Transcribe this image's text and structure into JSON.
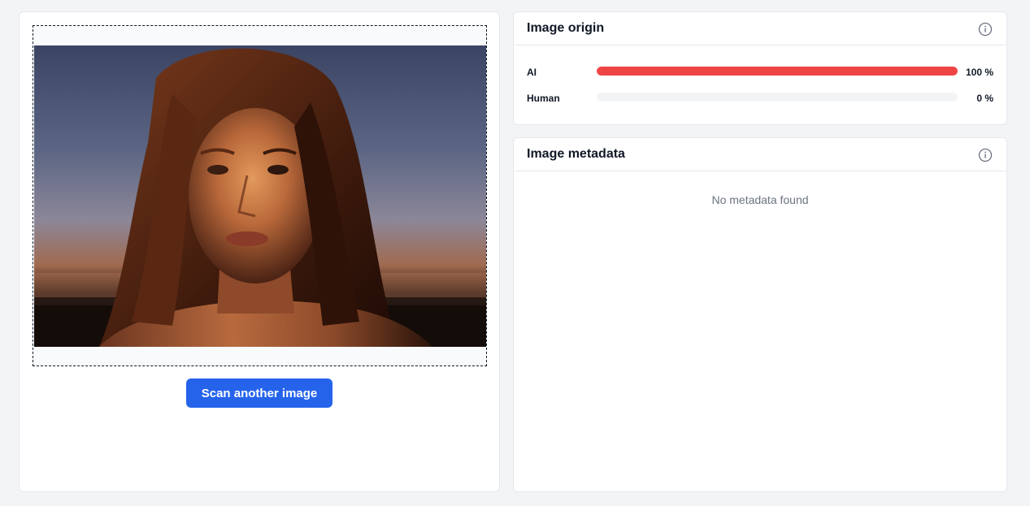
{
  "upload": {
    "image_alt": "Uploaded portrait photo",
    "scan_button_label": "Scan another image"
  },
  "origin": {
    "title": "Image origin",
    "info_icon": "info-icon",
    "rows": [
      {
        "label": "AI",
        "value_text": "100 %",
        "percent": 100,
        "color": "#ef4444"
      },
      {
        "label": "Human",
        "value_text": "0 %",
        "percent": 0,
        "color": "#9ca3af"
      }
    ]
  },
  "metadata": {
    "title": "Image metadata",
    "info_icon": "info-icon",
    "empty_text": "No metadata found"
  },
  "colors": {
    "accent": "#2563eb",
    "ai_bar": "#ef4444",
    "background": "#f3f4f6"
  }
}
